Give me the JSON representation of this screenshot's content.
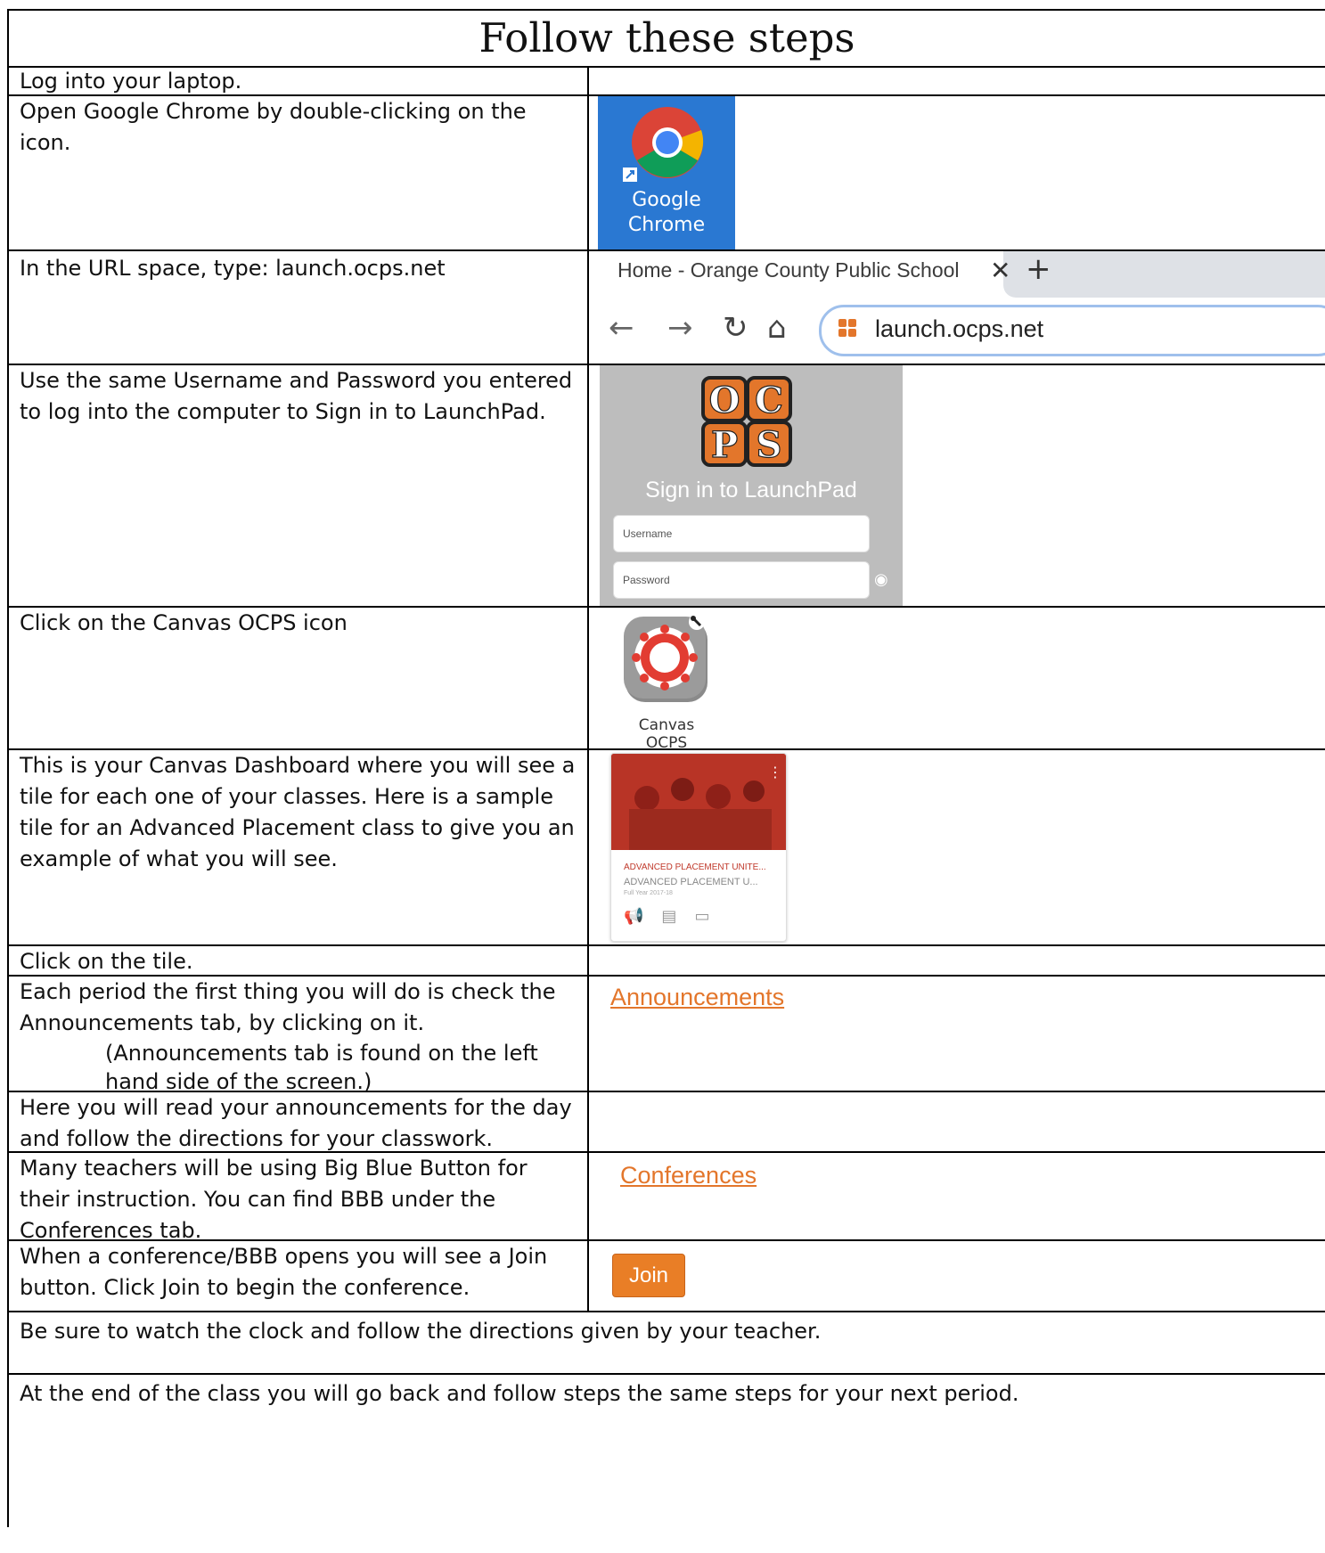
{
  "title": "Follow these steps",
  "steps": [
    {
      "text": "Log into your laptop."
    },
    {
      "text": "Open Google Chrome by double-clicking on the icon.",
      "chrome_label_1": "Google",
      "chrome_label_2": "Chrome",
      "icon": "chrome-icon"
    },
    {
      "text": "In the URL space, type: launch.ocps.net",
      "tab_title": "Home - Orange County Public School",
      "url": "launch.ocps.net"
    },
    {
      "text": "Use the same Username and Password you entered to log into the computer to Sign in to LaunchPad.",
      "logo_letters": [
        "O",
        "C",
        "P",
        "S"
      ],
      "signin_title": "Sign in to LaunchPad",
      "username_placeholder": "Username",
      "password_placeholder": "Password"
    },
    {
      "text": "Click on the Canvas OCPS icon",
      "icon_label": "Canvas OCPS"
    },
    {
      "text": "This is your Canvas Dashboard where you will see a tile for each one of your classes. Here is a sample tile for an Advanced Placement class to give you an example of what you will see.",
      "card_title": "ADVANCED PLACEMENT UNITE...",
      "card_subtitle": "ADVANCED PLACEMENT U...",
      "card_term": "Full Year 2017-18"
    },
    {
      "text": "Click on the tile."
    },
    {
      "text": "Each period the first thing you will do is check the Announcements tab, by clicking on it.",
      "note": "(Announcements tab is found on the left hand side of the screen.)",
      "link": "Announcements"
    },
    {
      "text": "Here you will read your announcements for the day and follow the directions for your classwork."
    },
    {
      "text": "Many teachers will be using Big Blue Button for their instruction. You can find BBB under the Conferences tab.",
      "link": "Conferences"
    },
    {
      "text": "When a conference/BBB opens you will see a Join button. Click Join to begin the conference.",
      "button": "Join"
    }
  ],
  "footer1": "Be sure to watch the clock and follow the directions given by your teacher.",
  "footer2": "At the end of the class you will go back and follow steps the same steps for your next period.",
  "colors": {
    "orange": "#e3762b",
    "chrome_bg": "#2a78d2",
    "card_red": "#c0392b"
  }
}
